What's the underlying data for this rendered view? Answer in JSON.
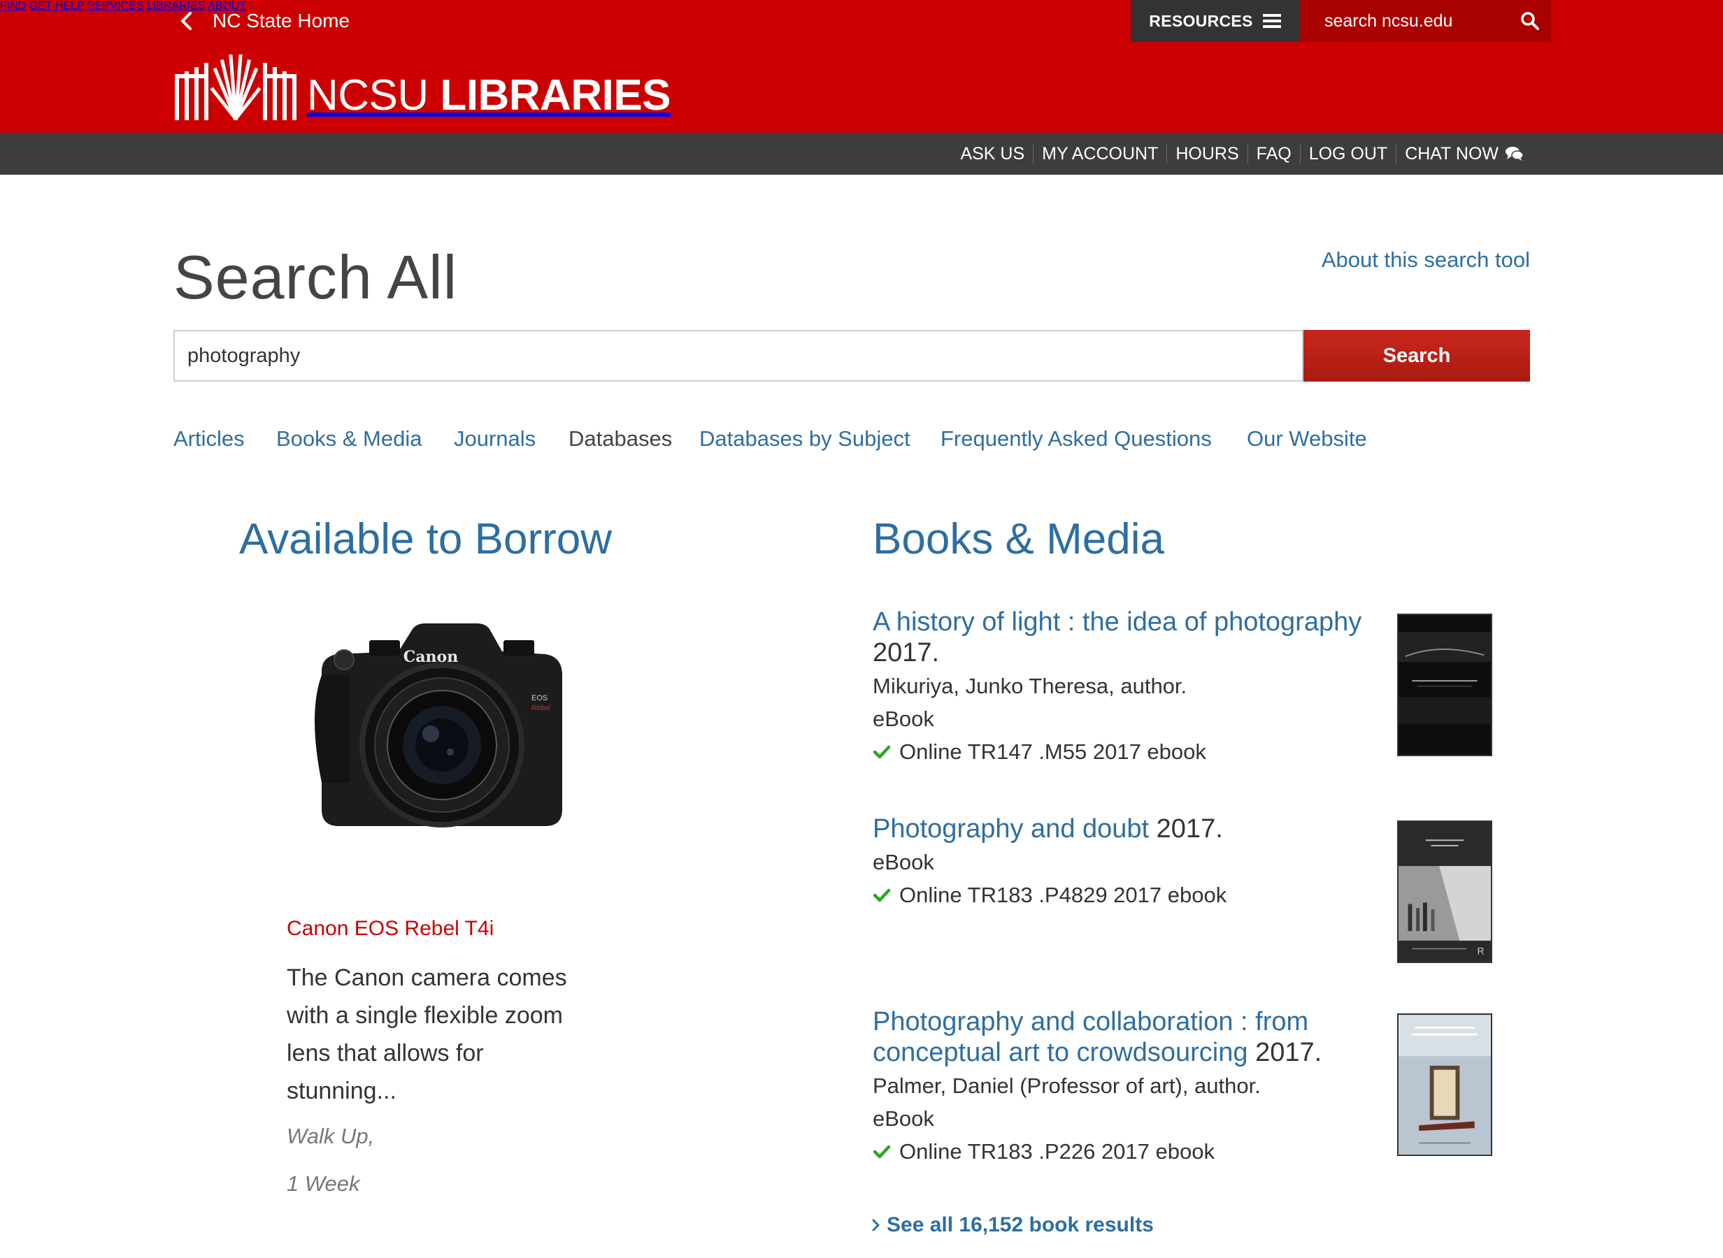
{
  "header": {
    "home_link": "NC State Home",
    "resources_label": "RESOURCES",
    "site_search_placeholder": "search ncsu.edu",
    "logo": {
      "light": "NCSU ",
      "bold": "LIBRARIES"
    },
    "nav": [
      "FIND",
      "GET HELP",
      "SERVICES",
      "LIBRARIES",
      "ABOUT"
    ],
    "brand_color": "#cc0000"
  },
  "utility": {
    "links": [
      "ASK US",
      "MY ACCOUNT",
      "HOURS",
      "FAQ",
      "LOG OUT",
      "CHAT NOW"
    ]
  },
  "search": {
    "title": "Search All",
    "about_link": "About this search tool",
    "query": "photography",
    "button": "Search",
    "tabs": [
      "Articles",
      "Books & Media",
      "Journals",
      "Databases",
      "Databases by Subject",
      "Frequently Asked Questions",
      "Our Website"
    ],
    "current_tab": "Databases"
  },
  "borrow": {
    "heading": "Available to Borrow",
    "camera_brand": "Canon",
    "item_name": "Canon EOS Rebel T4i",
    "description": "The Canon camera comes with a single flexible zoom lens that allows for stunning...",
    "location": "Walk Up,",
    "loan_period": "1 Week"
  },
  "books": {
    "heading": "Books & Media",
    "results": [
      {
        "title": "A history of light : the idea of photography",
        "year": " 2017.",
        "author": "Mikuriya, Junko Theresa, author.",
        "format": "eBook",
        "availability": "Online TR147 .M55 2017 ebook"
      },
      {
        "title": "Photography and doubt",
        "year": " 2017.",
        "format": "eBook",
        "availability": "Online TR183 .P4829 2017 ebook"
      },
      {
        "title": "Photography and collaboration : from conceptual art to crowdsourcing",
        "year": " 2017.",
        "author": "Palmer, Daniel (Professor of art), author.",
        "format": "eBook",
        "availability": "Online TR183 .P226 2017 ebook"
      }
    ],
    "see_all": "See all 16,152 book results"
  }
}
